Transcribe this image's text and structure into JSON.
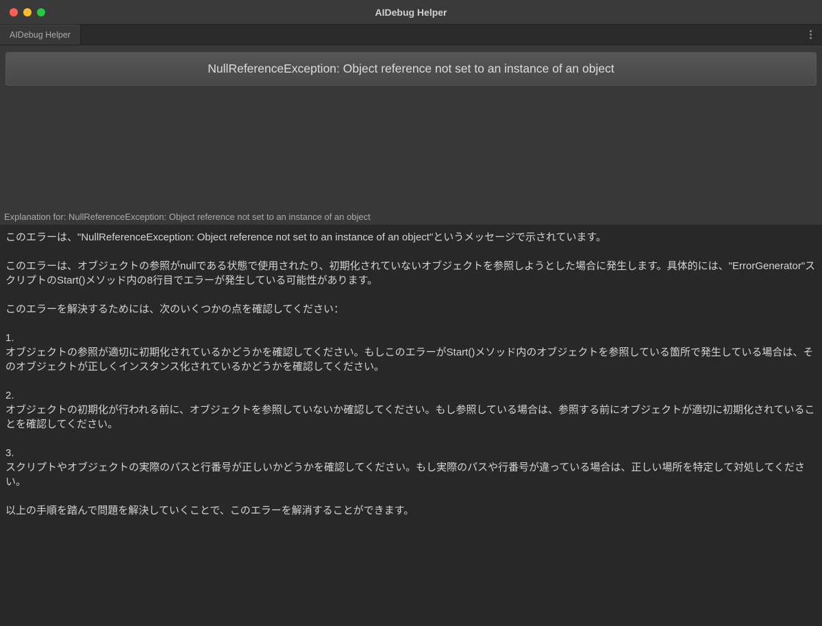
{
  "window": {
    "title": "AIDebug Helper"
  },
  "tab": {
    "label": "AIDebug Helper"
  },
  "error": {
    "message": "NullReferenceException: Object reference not set to an instance of an object"
  },
  "explanation": {
    "header": "Explanation for: NullReferenceException: Object reference not set to an instance of an object",
    "body": "このエラーは、\"NullReferenceException: Object reference not set to an instance of an object\"というメッセージで示されています。\n\nこのエラーは、オブジェクトの参照がnullである状態で使用されたり、初期化されていないオブジェクトを参照しようとした場合に発生します。具体的には、\"ErrorGenerator\"スクリプトのStart()メソッド内の8行目でエラーが発生している可能性があります。\n\nこのエラーを解決するためには、次のいくつかの点を確認してください：\n\n1.\nオブジェクトの参照が適切に初期化されているかどうかを確認してください。もしこのエラーがStart()メソッド内のオブジェクトを参照している箇所で発生している場合は、そのオブジェクトが正しくインスタンス化されているかどうかを確認してください。\n\n2.\nオブジェクトの初期化が行われる前に、オブジェクトを参照していないか確認してください。もし参照している場合は、参照する前にオブジェクトが適切に初期化されていることを確認してください。\n\n3.\nスクリプトやオブジェクトの実際のパスと行番号が正しいかどうかを確認してください。もし実際のパスや行番号が違っている場合は、正しい場所を特定して対処してください。\n\n以上の手順を踏んで問題を解決していくことで、このエラーを解消することができます。"
  }
}
